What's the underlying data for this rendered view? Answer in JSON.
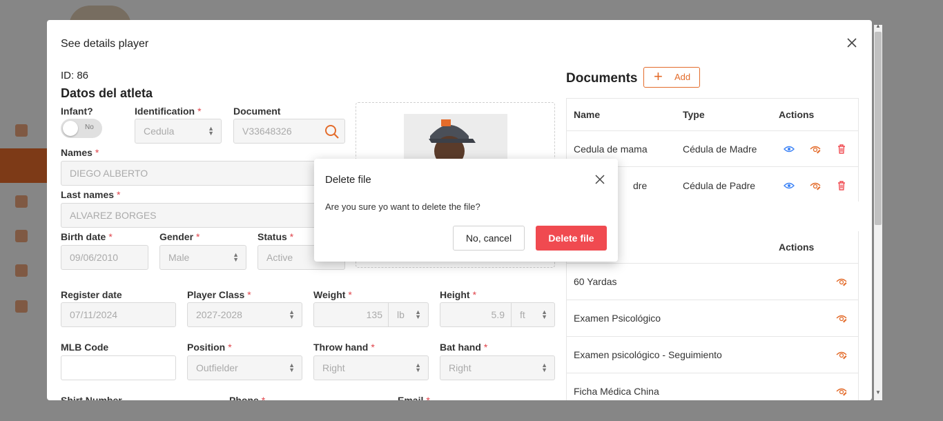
{
  "modal": {
    "title": "See details player",
    "player_id": "ID: 86",
    "section_title": "Datos del atleta"
  },
  "form": {
    "infant_label": "Infant?",
    "infant_toggle": "No",
    "identification_label": "Identification",
    "identification_value": "Cedula",
    "document_label": "Document",
    "document_value": "V33648326",
    "names_label": "Names",
    "names_value": "DIEGO ALBERTO",
    "lastnames_label": "Last names",
    "lastnames_value": "ALVAREZ BORGES",
    "birth_label": "Birth date",
    "birth_value": "09/06/2010",
    "gender_label": "Gender",
    "gender_value": "Male",
    "status_label": "Status",
    "status_value": "Active",
    "register_label": "Register date",
    "register_value": "07/11/2024",
    "class_label": "Player Class",
    "class_value": "2027-2028",
    "weight_label": "Weight",
    "weight_value": "135",
    "weight_unit": "lb",
    "height_label": "Height",
    "height_value": "5.9",
    "height_unit": "ft",
    "mlb_label": "MLB Code",
    "mlb_value": "",
    "position_label": "Position",
    "position_value": "Outfielder",
    "throw_label": "Throw hand",
    "throw_value": "Right",
    "bat_label": "Bat hand",
    "bat_value": "Right",
    "shirt_label": "Shirt Number",
    "phone_label": "Phone",
    "email_label": "Email",
    "required_mark": "*"
  },
  "documents": {
    "title": "Documents",
    "add_label": "Add",
    "headers": {
      "name": "Name",
      "type": "Type",
      "actions": "Actions"
    },
    "rows": [
      {
        "name": "Cedula de mama",
        "type": "Cédula de Madre"
      },
      {
        "name": "Cedula de padre",
        "name_visible": "dre",
        "type": "Cédula de Padre"
      }
    ]
  },
  "tests": {
    "actions_header": "Actions",
    "rows": [
      {
        "name": "60 Yardas"
      },
      {
        "name": "Examen Psicológico"
      },
      {
        "name": "Examen psicológico - Seguimiento"
      },
      {
        "name": "Ficha Médica China"
      }
    ]
  },
  "dialog": {
    "title": "Delete file",
    "message": "Are you sure yo want to delete the file?",
    "cancel_label": "No, cancel",
    "confirm_label": "Delete file"
  },
  "colors": {
    "accent": "#e36b2a",
    "danger": "#f04a50",
    "view_icon": "#3b82f6"
  }
}
